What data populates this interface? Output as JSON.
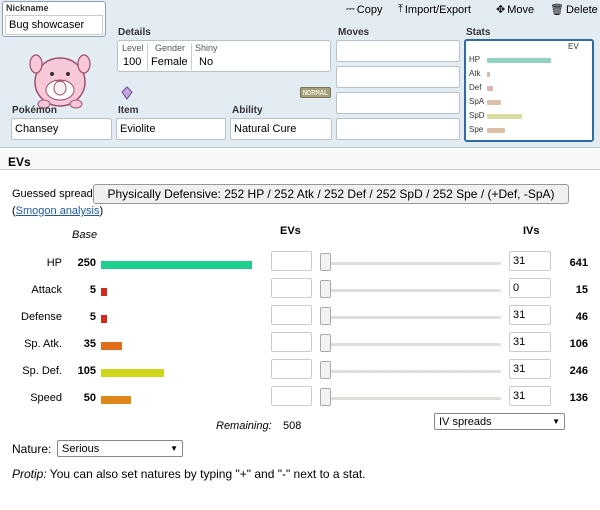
{
  "toolbar": {
    "copy_label": "Copy",
    "import_label": "Import/Export",
    "move_label": "Move",
    "delete_label": "Delete"
  },
  "nickname": {
    "label": "Nickname",
    "value": "Bug showcaser"
  },
  "details": {
    "header": "Details",
    "level_label": "Level",
    "level": "100",
    "gender_label": "Gender",
    "gender": "Female",
    "shiny_label": "Shiny",
    "shiny": "No"
  },
  "type_badge": "NORMAL",
  "pokemon": {
    "label": "Pokémon",
    "value": "Chansey"
  },
  "item": {
    "label": "Item",
    "value": "Eviolite"
  },
  "ability": {
    "label": "Ability",
    "value": "Natural Cure"
  },
  "moves": {
    "header": "Moves",
    "slots": [
      "",
      "",
      "",
      ""
    ]
  },
  "stats_panel": {
    "header": "Stats",
    "ev_label": "EV",
    "rows": [
      {
        "label": "HP",
        "level": 1.0,
        "color": "#91d2c1"
      },
      {
        "label": "Atk",
        "level": 0.05,
        "color": "#dcb3ae"
      },
      {
        "label": "Def",
        "level": 0.1,
        "color": "#dcb3ae"
      },
      {
        "label": "SpA",
        "level": 0.22,
        "color": "#dcbea9"
      },
      {
        "label": "SpD",
        "level": 0.55,
        "color": "#d9dca0"
      },
      {
        "label": "Spe",
        "level": 0.28,
        "color": "#dcbea9"
      }
    ]
  },
  "evs_section": {
    "title": "EVs",
    "guessed_label": "Guessed spread:",
    "guessed_value": "Physically Defensive: 252 HP / 252 Atk / 252 Def / 252 SpD / 252 Spe / (+Def, -SpA)",
    "smogon_paren_open": "(",
    "smogon_link": "Smogon analysis",
    "smogon_paren_close": ")",
    "base_header": "Base",
    "evs_header": "EVs",
    "ivs_header": "IVs",
    "max_base": 255,
    "rows": [
      {
        "name": "HP",
        "base": "250",
        "base_value": 250,
        "color": "#1fcf8c",
        "ev": "",
        "iv": "31",
        "total": "641"
      },
      {
        "name": "Attack",
        "base": "5",
        "base_value": 5,
        "color": "#d22b1c",
        "ev": "",
        "iv": "0",
        "total": "15"
      },
      {
        "name": "Defense",
        "base": "5",
        "base_value": 5,
        "color": "#d22b1c",
        "ev": "",
        "iv": "31",
        "total": "46"
      },
      {
        "name": "Sp. Atk.",
        "base": "35",
        "base_value": 35,
        "color": "#df6d19",
        "ev": "",
        "iv": "31",
        "total": "106"
      },
      {
        "name": "Sp. Def.",
        "base": "105",
        "base_value": 105,
        "color": "#cfd619",
        "ev": "",
        "iv": "31",
        "total": "246"
      },
      {
        "name": "Speed",
        "base": "50",
        "base_value": 50,
        "color": "#df8519",
        "ev": "",
        "iv": "31",
        "total": "136"
      }
    ],
    "remaining_label": "Remaining:",
    "remaining_value": "508",
    "iv_spreads_label": "IV spreads",
    "nature_label": "Nature:",
    "nature_value": "Serious",
    "protip_label": "Protip:",
    "protip_text": " You can also set natures by typing \"+\" and \"-\" next to a stat."
  }
}
